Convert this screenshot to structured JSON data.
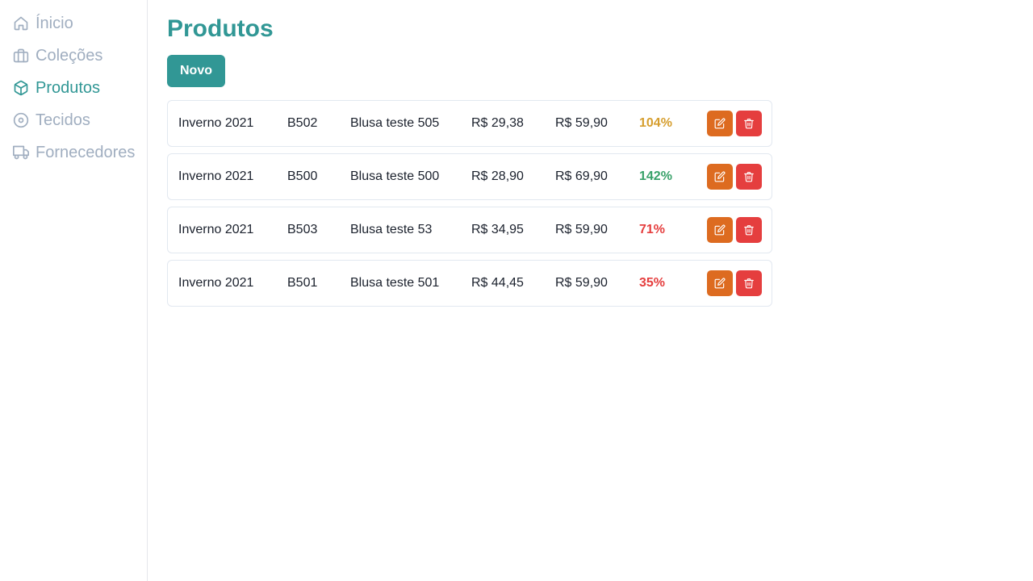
{
  "sidebar": {
    "items": [
      {
        "label": "Ínicio",
        "icon": "home-icon",
        "active": false
      },
      {
        "label": "Coleções",
        "icon": "briefcase-icon",
        "active": false
      },
      {
        "label": "Produtos",
        "icon": "package-icon",
        "active": true
      },
      {
        "label": "Tecidos",
        "icon": "disc-icon",
        "active": false
      },
      {
        "label": "Fornecedores",
        "icon": "truck-icon",
        "active": false
      }
    ]
  },
  "main": {
    "title": "Produtos",
    "new_button_label": "Novo"
  },
  "colors": {
    "accent": "#319795",
    "inactive_nav": "#a0aec0",
    "edit": "#dd6b20",
    "delete": "#e53e3e",
    "margin_high": "#38a169",
    "margin_mid": "#d69e2e",
    "margin_low": "#e53e3e"
  },
  "products": [
    {
      "collection": "Inverno 2021",
      "code": "B502",
      "name": "Blusa teste 505",
      "cost": "R$ 29,38",
      "price": "R$ 59,90",
      "margin": "104%",
      "margin_color": "#d69e2e"
    },
    {
      "collection": "Inverno 2021",
      "code": "B500",
      "name": "Blusa teste 500",
      "cost": "R$ 28,90",
      "price": "R$ 69,90",
      "margin": "142%",
      "margin_color": "#38a169"
    },
    {
      "collection": "Inverno 2021",
      "code": "B503",
      "name": "Blusa teste 53",
      "cost": "R$ 34,95",
      "price": "R$ 59,90",
      "margin": "71%",
      "margin_color": "#e53e3e"
    },
    {
      "collection": "Inverno 2021",
      "code": "B501",
      "name": "Blusa teste 501",
      "cost": "R$ 44,45",
      "price": "R$ 59,90",
      "margin": "35%",
      "margin_color": "#e53e3e"
    }
  ]
}
